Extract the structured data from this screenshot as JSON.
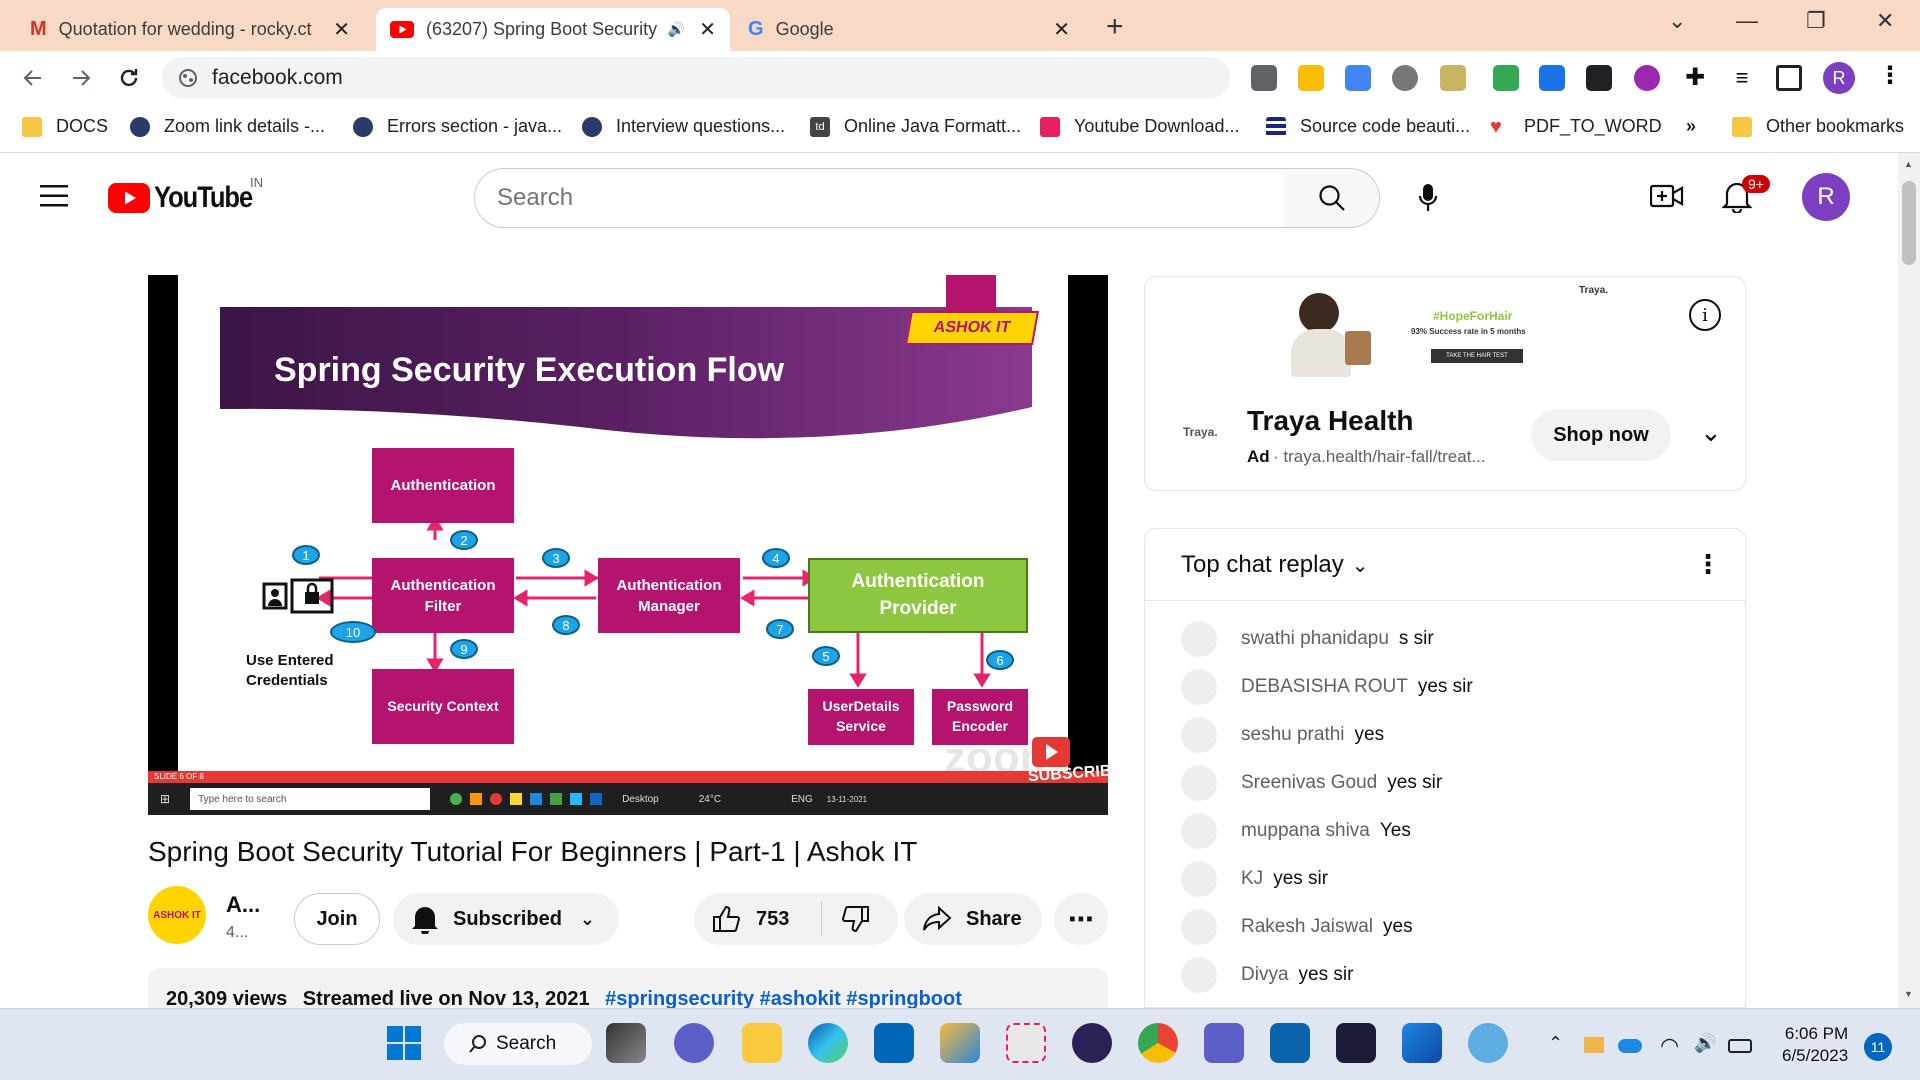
{
  "browser": {
    "tabs": [
      {
        "title": "Quotation for wedding - rocky.ct",
        "icon": "gmail-icon",
        "active": false
      },
      {
        "title": "(63207) Spring Boot Security",
        "icon": "youtube-icon",
        "active": true
      },
      {
        "title": "Google",
        "icon": "google-icon",
        "active": false
      }
    ],
    "url": "facebook.com",
    "profile_initial": "R",
    "bookmarks": [
      {
        "label": "DOCS",
        "icon": "folder-icon"
      },
      {
        "label": "Zoom link details -...",
        "icon": "star-badge-icon"
      },
      {
        "label": "Errors section - java...",
        "icon": "star-badge-icon"
      },
      {
        "label": "Interview questions...",
        "icon": "star-badge-icon"
      },
      {
        "label": "Online Java Formatt...",
        "icon": "td-icon"
      },
      {
        "label": "Youtube Download...",
        "icon": "download-icon"
      },
      {
        "label": "Source code beauti...",
        "icon": "lines-icon"
      },
      {
        "label": "PDF_TO_WORD",
        "icon": "heart-icon"
      }
    ],
    "more_bookmarks": "»",
    "other_bookmarks": "Other bookmarks"
  },
  "youtube": {
    "logo_text": "YouTube",
    "region": "IN",
    "search_placeholder": "Search",
    "notifications": "9+",
    "avatar_initial": "R"
  },
  "slide": {
    "title": "Spring Security Execution Flow",
    "brand": "ASHOK IT",
    "boxes": {
      "authentication": "Authentication",
      "filter": "Authentication Filter",
      "manager": "Authentication Manager",
      "provider": "Authentication Provider",
      "context": "Security Context",
      "userdetails": "UserDetails Service",
      "encoder": "Password Encoder"
    },
    "credentials_label": "Use Entered Credentials",
    "steps": [
      "1",
      "2",
      "3",
      "4",
      "5",
      "6",
      "7",
      "8",
      "9",
      "10"
    ],
    "subscribe": "SUBSCRIBE",
    "zoom_watermark": "zoom",
    "inner_taskbar": {
      "search": "Type here to search",
      "desktop": "Desktop",
      "temp": "24°C",
      "lang": "ENG",
      "date": "13-11-2021",
      "slide_no": "SLIDE 6 OF 8"
    }
  },
  "video": {
    "title": "Spring Boot Security Tutorial For Beginners | Part-1 | Ashok IT",
    "channel_short": "A...",
    "subs_short": "4...",
    "channel_logo": "ASHOK IT",
    "join": "Join",
    "subscribed": "Subscribed",
    "likes": "753",
    "share": "Share",
    "views": "20,309 views",
    "streamed": "Streamed live on Nov 13, 2021",
    "hashtags": "#springsecurity #ashokit #springboot"
  },
  "ad": {
    "banner_brand": "Traya.",
    "banner_tag": "#HopeForHair",
    "banner_line": "93% Success rate in 5 months",
    "banner_cta": "TAKE THE HAIR TEST",
    "logo_text": "Traya.",
    "name": "Traya Health",
    "ad_label": "Ad",
    "url": "traya.health/hair-fall/treat...",
    "cta": "Shop now"
  },
  "chat": {
    "header": "Top chat replay",
    "messages": [
      {
        "author": "swathi phanidapu",
        "text": "s sir"
      },
      {
        "author": "DEBASISHA ROUT",
        "text": "yes sir"
      },
      {
        "author": "seshu prathi",
        "text": "yes"
      },
      {
        "author": "Sreenivas Goud",
        "text": "yes sir"
      },
      {
        "author": "muppana shiva",
        "text": "Yes"
      },
      {
        "author": "KJ",
        "text": "yes sir"
      },
      {
        "author": "Rakesh Jaiswal",
        "text": "yes"
      },
      {
        "author": "Divya",
        "text": "yes sir"
      }
    ]
  },
  "taskbar": {
    "search": "Search",
    "time": "6:06 PM",
    "date": "6/5/2023",
    "notification_count": "11"
  },
  "colors": {
    "tabstrip": "#f8d9c6",
    "youtube_red": "#ff0000",
    "slide_magenta": "#b5146e",
    "slide_green": "#8dc63f",
    "slide_purple": "#3b1545",
    "avatar_purple": "#7b3fbf",
    "arrow_red": "#e3246f"
  }
}
